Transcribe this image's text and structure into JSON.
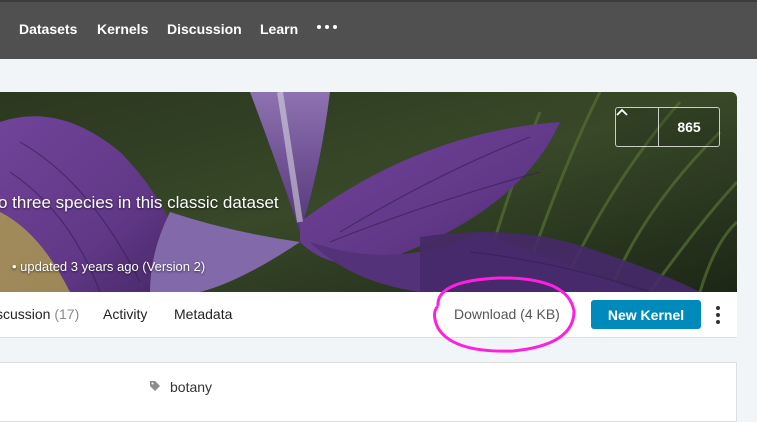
{
  "nav": {
    "links": [
      "Datasets",
      "Kernels",
      "Discussion",
      "Learn"
    ],
    "more_icon": "more-horizontal-icon"
  },
  "hero": {
    "title": "o three species in this classic dataset",
    "subtitle": "• updated 3 years ago (Version 2)",
    "upvote_icon": "chevron-up-icon",
    "vote_count": "865"
  },
  "tabs": {
    "discussion_label": "scussion",
    "discussion_count": "(17)",
    "activity_label": "Activity",
    "metadata_label": "Metadata"
  },
  "actions": {
    "download_label": "Download (4 KB)",
    "new_kernel_label": "New Kernel",
    "more_icon": "kebab-vertical-icon",
    "annotation_color": "#ff1fe0"
  },
  "card": {
    "tag_icon": "tag-icon",
    "tag_label": "botany"
  },
  "colors": {
    "nav_bg": "#505050",
    "primary_button": "#008abc",
    "page_bg": "#f2f5f7"
  }
}
